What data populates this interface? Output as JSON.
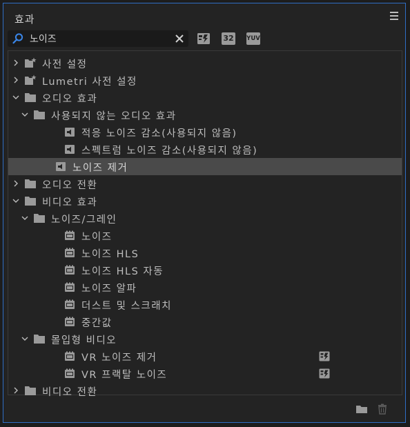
{
  "panel": {
    "title": "효과"
  },
  "search": {
    "value": "노이즈"
  },
  "tree": [
    {
      "label": "사전 설정",
      "depth": 0,
      "kind": "preset-folder",
      "chevron": "right"
    },
    {
      "label": "Lumetri 사전 설정",
      "depth": 0,
      "kind": "preset-folder",
      "chevron": "right"
    },
    {
      "label": "오디오 효과",
      "depth": 0,
      "kind": "folder",
      "chevron": "down"
    },
    {
      "label": "사용되지 않는 오디오 효과",
      "depth": 1,
      "kind": "folder",
      "chevron": "down"
    },
    {
      "label": "적응 노이즈 감소(사용되지 않음)",
      "depth": 2,
      "kind": "audio-effect"
    },
    {
      "label": "스펙트럼 노이즈 감소(사용되지 않음)",
      "depth": 2,
      "kind": "audio-effect"
    },
    {
      "label": "노이즈 제거",
      "depth": 1,
      "kind": "audio-effect",
      "selected": true
    },
    {
      "label": "오디오 전환",
      "depth": 0,
      "kind": "folder",
      "chevron": "right"
    },
    {
      "label": "비디오 효과",
      "depth": 0,
      "kind": "folder",
      "chevron": "down"
    },
    {
      "label": "노이즈/그레인",
      "depth": 1,
      "kind": "folder",
      "chevron": "down"
    },
    {
      "label": "노이즈",
      "depth": 2,
      "kind": "video-effect"
    },
    {
      "label": "노이즈 HLS",
      "depth": 2,
      "kind": "video-effect"
    },
    {
      "label": "노이즈 HLS 자동",
      "depth": 2,
      "kind": "video-effect"
    },
    {
      "label": "노이즈 알파",
      "depth": 2,
      "kind": "video-effect"
    },
    {
      "label": "더스트 및 스크래치",
      "depth": 2,
      "kind": "video-effect"
    },
    {
      "label": "중간값",
      "depth": 2,
      "kind": "video-effect"
    },
    {
      "label": "몰입형 비디오",
      "depth": 1,
      "kind": "folder",
      "chevron": "down"
    },
    {
      "label": "VR 노이즈 제거",
      "depth": 2,
      "kind": "video-effect",
      "accelerated": true
    },
    {
      "label": "VR 프랙탈 노이즈",
      "depth": 2,
      "kind": "video-effect",
      "accelerated": true
    },
    {
      "label": "비디오 전환",
      "depth": 0,
      "kind": "folder",
      "chevron": "right"
    }
  ],
  "filters": {
    "bits32": "32",
    "yuv": "YUV"
  },
  "colors": {
    "accent": "#2f6fc7",
    "search_icon": "#3a86e8",
    "selected_row": "#4a4a4a"
  }
}
